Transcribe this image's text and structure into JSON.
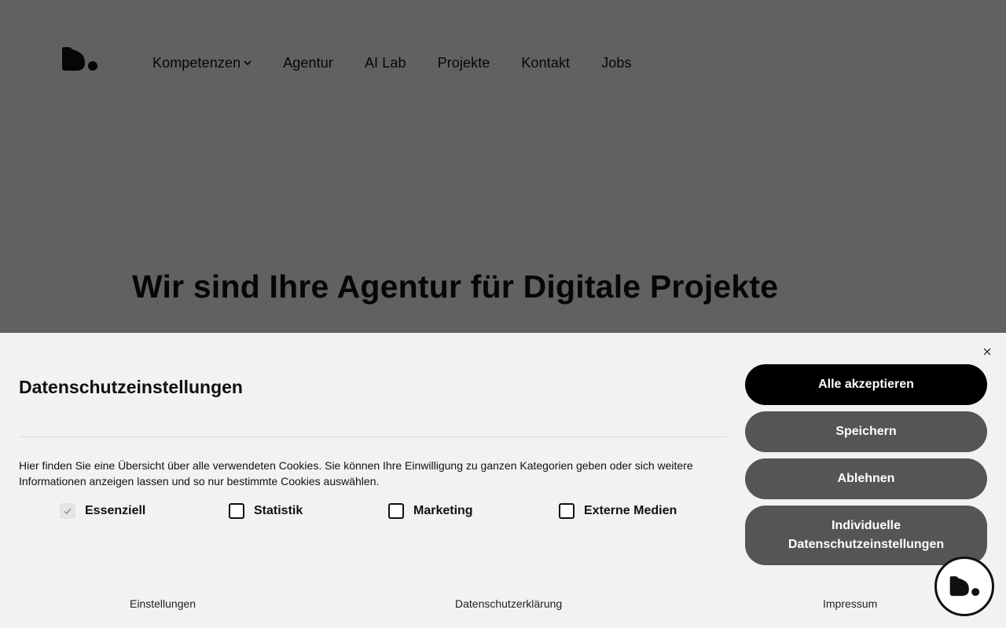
{
  "header": {
    "logo_icon": "agency-logo-icon",
    "nav": [
      {
        "label": "Kompetenzen",
        "has_dropdown": true
      },
      {
        "label": "Agentur"
      },
      {
        "label": "AI Lab"
      },
      {
        "label": "Projekte"
      },
      {
        "label": "Kontakt"
      },
      {
        "label": "Jobs"
      }
    ]
  },
  "hero": {
    "title": "Wir sind Ihre Agentur für Digitale Projekte"
  },
  "cookie_banner": {
    "title": "Datenschutzeinstellungen",
    "description": "Hier finden Sie eine Übersicht über alle verwendeten Cookies. Sie können Ihre Einwilligung zu ganzen Kategorien geben oder sich weitere Informationen anzeigen lassen und so nur bestimmte Cookies auswählen.",
    "categories": [
      {
        "label": "Essenziell",
        "checked": true,
        "disabled": true
      },
      {
        "label": "Statistik",
        "checked": false
      },
      {
        "label": "Marketing",
        "checked": false
      },
      {
        "label": "Externe Medien",
        "checked": false
      }
    ],
    "buttons": {
      "accept_all": "Alle akzeptieren",
      "save": "Speichern",
      "reject": "Ablehnen",
      "individual": "Individuelle Datenschutzeinstellungen"
    },
    "footer_links": [
      "Einstellungen",
      "Datenschutzerklärung",
      "Impressum"
    ],
    "close_icon": "close-icon"
  },
  "colors": {
    "overlay": "#636260",
    "banner_bg": "#f3f2f0",
    "primary_button": "#000000",
    "secondary_button": "#555555"
  }
}
